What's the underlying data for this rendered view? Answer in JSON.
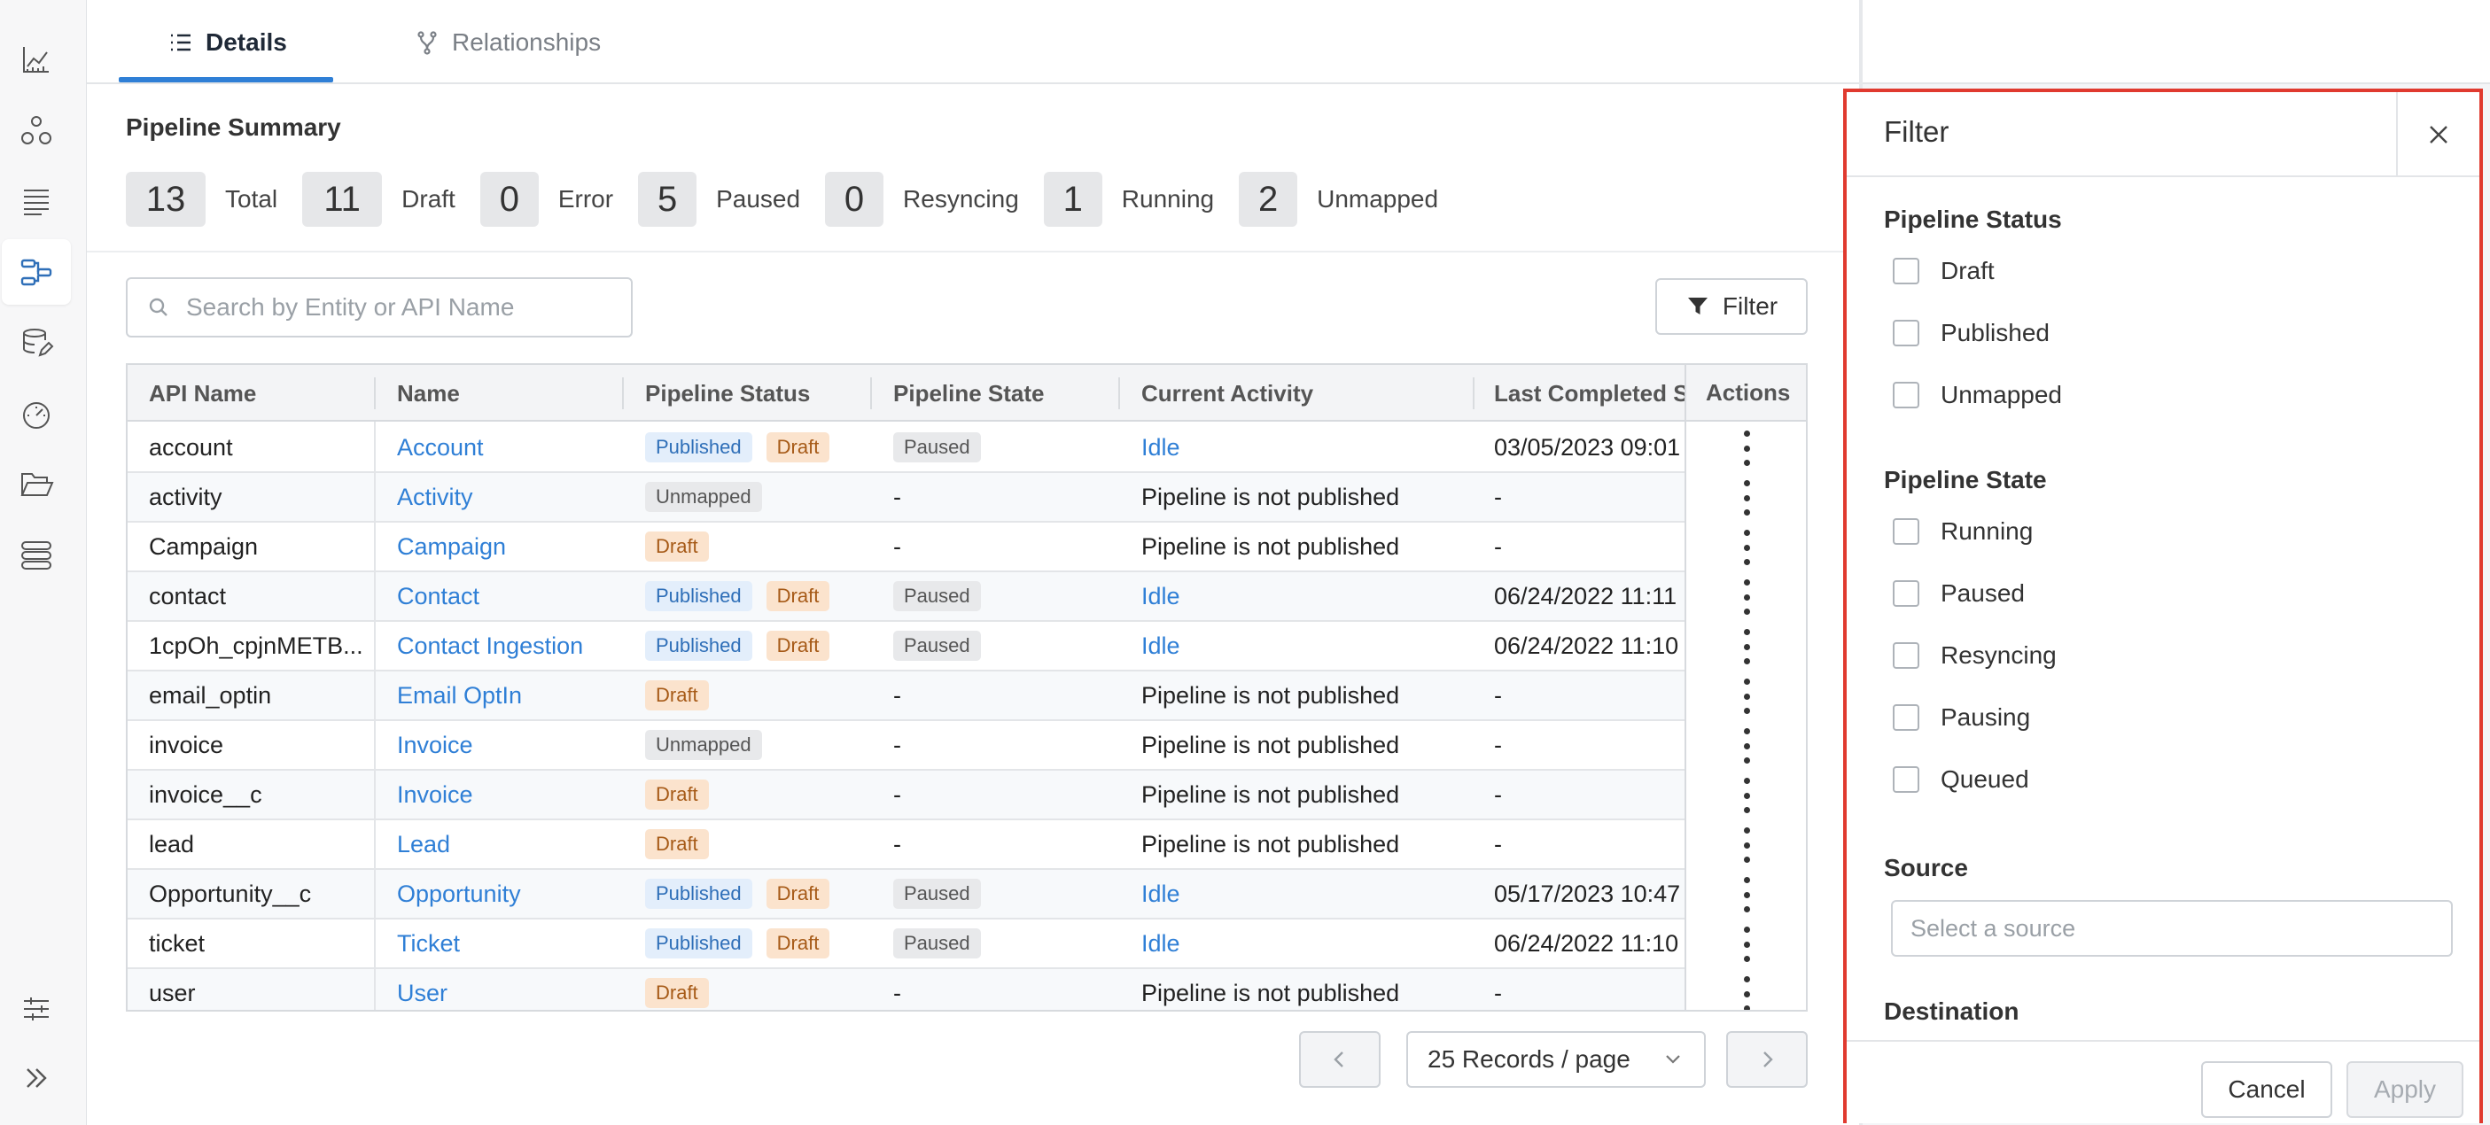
{
  "tabs": [
    {
      "label": "Details",
      "icon": "list-icon"
    },
    {
      "label": "Relationships",
      "icon": "relationships-icon"
    }
  ],
  "summary": {
    "title": "Pipeline Summary",
    "stats": [
      {
        "value": "13",
        "label": "Total"
      },
      {
        "value": "11",
        "label": "Draft"
      },
      {
        "value": "0",
        "label": "Error"
      },
      {
        "value": "5",
        "label": "Paused"
      },
      {
        "value": "0",
        "label": "Resyncing"
      },
      {
        "value": "1",
        "label": "Running"
      },
      {
        "value": "2",
        "label": "Unmapped"
      }
    ]
  },
  "search": {
    "placeholder": "Search by Entity or API Name"
  },
  "filter_button": {
    "label": "Filter"
  },
  "table": {
    "columns": [
      "API Name",
      "Name",
      "Pipeline Status",
      "Pipeline State",
      "Current Activity",
      "Last Completed Sy",
      "Actions"
    ],
    "rows": [
      {
        "api": "account",
        "name": "Account",
        "status": [
          "Published",
          "Draft"
        ],
        "state": "Paused",
        "activity": "Idle",
        "activity_link": true,
        "last": "03/05/2023 09:01"
      },
      {
        "api": "activity",
        "name": "Activity",
        "status": [
          "Unmapped"
        ],
        "state": "-",
        "activity": "Pipeline is not published",
        "activity_link": false,
        "last": "-"
      },
      {
        "api": "Campaign",
        "name": "Campaign",
        "status": [
          "Draft"
        ],
        "state": "-",
        "activity": "Pipeline is not published",
        "activity_link": false,
        "last": "-"
      },
      {
        "api": "contact",
        "name": "Contact",
        "status": [
          "Published",
          "Draft"
        ],
        "state": "Paused",
        "activity": "Idle",
        "activity_link": true,
        "last": "06/24/2022 11:11"
      },
      {
        "api": "1cpOh_cpjnMETB...",
        "name": "Contact Ingestion",
        "status": [
          "Published",
          "Draft"
        ],
        "state": "Paused",
        "activity": "Idle",
        "activity_link": true,
        "last": "06/24/2022 11:10"
      },
      {
        "api": "email_optin",
        "name": "Email OptIn",
        "status": [
          "Draft"
        ],
        "state": "-",
        "activity": "Pipeline is not published",
        "activity_link": false,
        "last": "-"
      },
      {
        "api": "invoice",
        "name": "Invoice",
        "status": [
          "Unmapped"
        ],
        "state": "-",
        "activity": "Pipeline is not published",
        "activity_link": false,
        "last": "-"
      },
      {
        "api": "invoice__c",
        "name": "Invoice",
        "status": [
          "Draft"
        ],
        "state": "-",
        "activity": "Pipeline is not published",
        "activity_link": false,
        "last": "-"
      },
      {
        "api": "lead",
        "name": "Lead",
        "status": [
          "Draft"
        ],
        "state": "-",
        "activity": "Pipeline is not published",
        "activity_link": false,
        "last": "-"
      },
      {
        "api": "Opportunity__c",
        "name": "Opportunity",
        "status": [
          "Published",
          "Draft"
        ],
        "state": "Paused",
        "activity": "Idle",
        "activity_link": true,
        "last": "05/17/2023 10:47"
      },
      {
        "api": "ticket",
        "name": "Ticket",
        "status": [
          "Published",
          "Draft"
        ],
        "state": "Paused",
        "activity": "Idle",
        "activity_link": true,
        "last": "06/24/2022 11:10"
      },
      {
        "api": "user",
        "name": "User",
        "status": [
          "Draft"
        ],
        "state": "-",
        "activity": "Pipeline is not published",
        "activity_link": false,
        "last": "-"
      }
    ]
  },
  "pagination": {
    "page_size": "25 Records / page"
  },
  "filter_panel": {
    "title": "Filter",
    "pipeline_status": {
      "title": "Pipeline Status",
      "options": [
        "Draft",
        "Published",
        "Unmapped"
      ]
    },
    "pipeline_state": {
      "title": "Pipeline State",
      "options": [
        "Running",
        "Paused",
        "Resyncing",
        "Pausing",
        "Queued"
      ]
    },
    "source": {
      "title": "Source",
      "placeholder": "Select a source"
    },
    "destination": {
      "title": "Destination"
    },
    "cancel_label": "Cancel",
    "apply_label": "Apply"
  },
  "colors": {
    "accent": "#2f7fd6",
    "highlight_border": "#e03a2f"
  }
}
